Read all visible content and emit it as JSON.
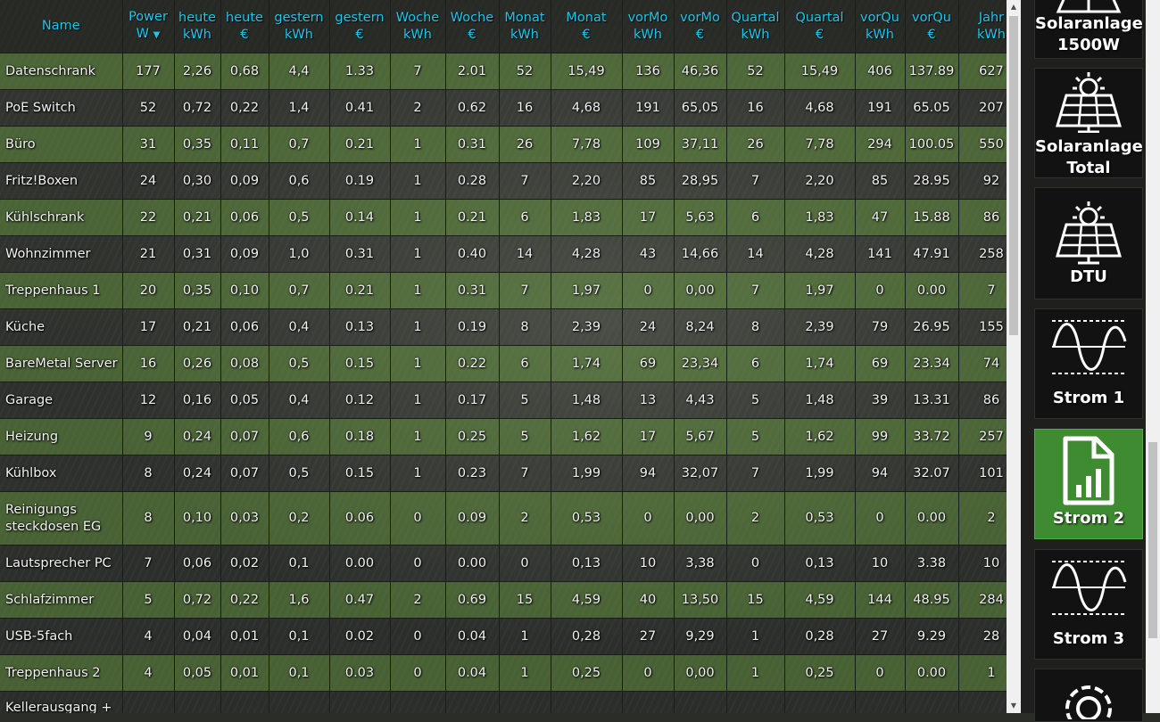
{
  "table": {
    "headers": [
      {
        "l1": "Name",
        "l2": ""
      },
      {
        "l1": "Power",
        "l2": "W",
        "sorted": true
      },
      {
        "l1": "heute",
        "l2": "kWh"
      },
      {
        "l1": "heute",
        "l2": "€"
      },
      {
        "l1": "gestern",
        "l2": "kWh"
      },
      {
        "l1": "gestern",
        "l2": "€"
      },
      {
        "l1": "Woche",
        "l2": "kWh"
      },
      {
        "l1": "Woche",
        "l2": "€"
      },
      {
        "l1": "Monat",
        "l2": "kWh"
      },
      {
        "l1": "Monat",
        "l2": "€"
      },
      {
        "l1": "vorMo",
        "l2": "kWh"
      },
      {
        "l1": "vorMo",
        "l2": "€"
      },
      {
        "l1": "Quartal",
        "l2": "kWh"
      },
      {
        "l1": "Quartal",
        "l2": "€"
      },
      {
        "l1": "vorQu",
        "l2": "kWh"
      },
      {
        "l1": "vorQu",
        "l2": "€"
      },
      {
        "l1": "Jahr",
        "l2": "kWh"
      }
    ],
    "sort_indicator": "▼",
    "rows": [
      [
        "Datenschrank",
        "177",
        "2,26",
        "0,68",
        "4,4",
        "1.33",
        "7",
        "2.01",
        "52",
        "15,49",
        "136",
        "46,36",
        "52",
        "15,49",
        "406",
        "137.89",
        "627"
      ],
      [
        "PoE Switch",
        "52",
        "0,72",
        "0,22",
        "1,4",
        "0.41",
        "2",
        "0.62",
        "16",
        "4,68",
        "191",
        "65,05",
        "16",
        "4,68",
        "191",
        "65.05",
        "207"
      ],
      [
        "Büro",
        "31",
        "0,35",
        "0,11",
        "0,7",
        "0.21",
        "1",
        "0.31",
        "26",
        "7,78",
        "109",
        "37,11",
        "26",
        "7,78",
        "294",
        "100.05",
        "550"
      ],
      [
        "Fritz!Boxen",
        "24",
        "0,30",
        "0,09",
        "0,6",
        "0.19",
        "1",
        "0.28",
        "7",
        "2,20",
        "85",
        "28,95",
        "7",
        "2,20",
        "85",
        "28.95",
        "92"
      ],
      [
        "Kühlschrank",
        "22",
        "0,21",
        "0,06",
        "0,5",
        "0.14",
        "1",
        "0.21",
        "6",
        "1,83",
        "17",
        "5,63",
        "6",
        "1,83",
        "47",
        "15.88",
        "86"
      ],
      [
        "Wohnzimmer",
        "21",
        "0,31",
        "0,09",
        "1,0",
        "0.31",
        "1",
        "0.40",
        "14",
        "4,28",
        "43",
        "14,66",
        "14",
        "4,28",
        "141",
        "47.91",
        "258"
      ],
      [
        "Treppenhaus 1",
        "20",
        "0,35",
        "0,10",
        "0,7",
        "0.21",
        "1",
        "0.31",
        "7",
        "1,97",
        "0",
        "0,00",
        "7",
        "1,97",
        "0",
        "0.00",
        "7"
      ],
      [
        "Küche",
        "17",
        "0,21",
        "0,06",
        "0,4",
        "0.13",
        "1",
        "0.19",
        "8",
        "2,39",
        "24",
        "8,24",
        "8",
        "2,39",
        "79",
        "26.95",
        "155"
      ],
      [
        "BareMetal Server",
        "16",
        "0,26",
        "0,08",
        "0,5",
        "0.15",
        "1",
        "0.22",
        "6",
        "1,74",
        "69",
        "23,34",
        "6",
        "1,74",
        "69",
        "23.34",
        "74"
      ],
      [
        "Garage",
        "12",
        "0,16",
        "0,05",
        "0,4",
        "0.12",
        "1",
        "0.17",
        "5",
        "1,48",
        "13",
        "4,43",
        "5",
        "1,48",
        "39",
        "13.31",
        "86"
      ],
      [
        "Heizung",
        "9",
        "0,24",
        "0,07",
        "0,6",
        "0.18",
        "1",
        "0.25",
        "5",
        "1,62",
        "17",
        "5,67",
        "5",
        "1,62",
        "99",
        "33.72",
        "257"
      ],
      [
        "Kühlbox",
        "8",
        "0,24",
        "0,07",
        "0,5",
        "0.15",
        "1",
        "0.23",
        "7",
        "1,99",
        "94",
        "32,07",
        "7",
        "1,99",
        "94",
        "32.07",
        "101"
      ],
      [
        "Reinigungs steckdosen EG",
        "8",
        "0,10",
        "0,03",
        "0,2",
        "0.06",
        "0",
        "0.09",
        "2",
        "0,53",
        "0",
        "0,00",
        "2",
        "0,53",
        "0",
        "0.00",
        "2"
      ],
      [
        "Lautsprecher PC",
        "7",
        "0,06",
        "0,02",
        "0,1",
        "0.00",
        "0",
        "0.00",
        "0",
        "0,13",
        "10",
        "3,38",
        "0",
        "0,13",
        "10",
        "3.38",
        "10"
      ],
      [
        "Schlafzimmer",
        "5",
        "0,72",
        "0,22",
        "1,6",
        "0.47",
        "2",
        "0.69",
        "15",
        "4,59",
        "40",
        "13,50",
        "15",
        "4,59",
        "144",
        "48.95",
        "284"
      ],
      [
        "USB-5fach",
        "4",
        "0,04",
        "0,01",
        "0,1",
        "0.02",
        "0",
        "0.04",
        "1",
        "0,28",
        "27",
        "9,29",
        "1",
        "0,28",
        "27",
        "9.29",
        "28"
      ],
      [
        "Treppenhaus 2",
        "4",
        "0,05",
        "0,01",
        "0,1",
        "0.03",
        "0",
        "0.04",
        "1",
        "0,25",
        "0",
        "0,00",
        "1",
        "0,25",
        "0",
        "0.00",
        "1"
      ],
      [
        "Kellerausgang +",
        "",
        "",
        "",
        "",
        "",
        "",
        "",
        "",
        "",
        "",
        "",
        "",
        "",
        "",
        "",
        ""
      ]
    ]
  },
  "sidebar": {
    "tiles": [
      {
        "label": "Solaranlage 1500W",
        "icon": "solar-panel-icon"
      },
      {
        "label": "Solaranlage Total",
        "icon": "solar-panel-icon"
      },
      {
        "label": "DTU",
        "icon": "solar-panel-icon"
      },
      {
        "label": "Strom 1",
        "icon": "sine-wave-icon"
      },
      {
        "label": "Strom 2",
        "icon": "chart-document-icon",
        "active": true
      },
      {
        "label": "Strom 3",
        "icon": "sine-wave-icon"
      },
      {
        "label": "",
        "icon": "gear-icon"
      }
    ]
  },
  "colors": {
    "header_text": "#19c8f0",
    "row_green": "#58803a",
    "active_tile": "#3f8b31"
  }
}
